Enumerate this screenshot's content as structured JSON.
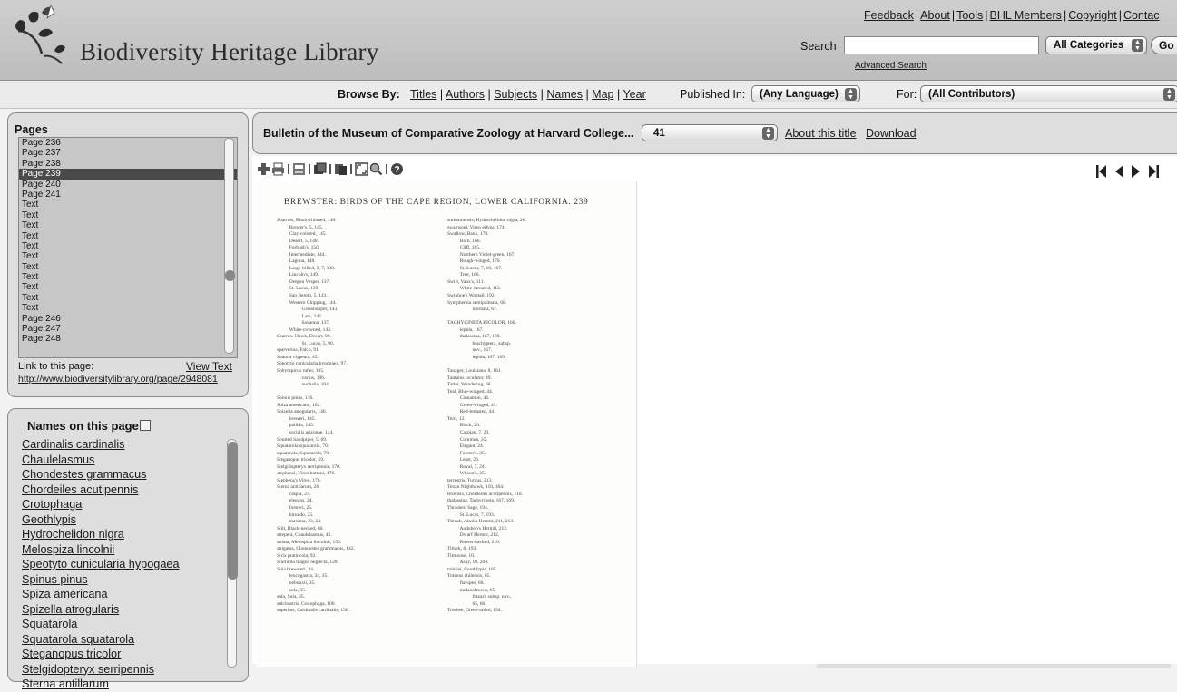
{
  "header": {
    "site_title": "Biodiversity Heritage Library",
    "top_links": [
      "Feedback",
      "About",
      "Tools",
      "BHL Members",
      "Copyright",
      "Contac"
    ],
    "search_label": "Search",
    "search_value": "",
    "category_selected": "All Categories",
    "go_label": "Go",
    "advanced_search": "Advanced Search"
  },
  "browse": {
    "label": "Browse By:",
    "links": [
      "Titles",
      "Authors",
      "Subjects",
      "Names",
      "Map",
      "Year"
    ],
    "published_label": "Published In:",
    "language_selected": "(Any Language)",
    "for_label": "For:",
    "contributors_selected": "(All Contributors)"
  },
  "pages_panel": {
    "title": "Pages",
    "pages": [
      "Page 236",
      "Page 237",
      "Page 238",
      "Page 239",
      "Page 240",
      "Page 241",
      "Text",
      "Text",
      "Text",
      "Text",
      "Text",
      "Text",
      "Text",
      "Text",
      "Text",
      "Text",
      "Text",
      "Page 246",
      "Page 247",
      "Page 248"
    ],
    "selected_index": 3,
    "link_label": "Link to this page:",
    "view_text": "View Text",
    "page_url": "http://www.biodiversitylibrary.org/page/2948081"
  },
  "names_panel": {
    "title": "Names on this page",
    "names": [
      "Cardinalis cardinalis",
      "Chaulelasmus",
      "Chondestes grammacus",
      "Chordeiles acutipennis",
      "Crotophaga",
      "Geothlypis",
      "Hydrochelidon nigra",
      "Melospiza lincolnii",
      "Speotyto cunicularia hypogaea",
      "Spinus pinus",
      "Spiza americana",
      "Spizella atrogularis",
      "Squatarola",
      "Squatarola squatarola",
      "Steganopus tricolor",
      "Stelgidopteryx serripennis",
      "Sterna antillarum"
    ]
  },
  "title_bar": {
    "book_title": "Bulletin of the Museum of Comparative Zoology at Harvard College...",
    "volume_selected": "41",
    "about_title": "About this title",
    "download": "Download"
  },
  "toolbar_icons": [
    "zoom-in-icon",
    "print-icon",
    "info-icon",
    "save-icon",
    "page-view-icon",
    "two-page-icon",
    "fullscreen-icon",
    "search-text-icon",
    "help-icon"
  ],
  "document": {
    "header": "BREWSTER: BIRDS OF THE CAPE REGION, LOWER CALIFORNIA.   239",
    "left_column": [
      "Sparrow, Black-chinned, 148.",
      "          Brewer's, 5, 145.",
      "          Clay-colored, 145.",
      "          Desert, 5, 148.",
      "          Forbush's, 150.",
      "          Intermediate, 144.",
      "          Laguna, 148.",
      "          Large-billed, 5, 7, 138.",
      "          Lincoln's, 149.",
      "          Oregon Vesper, 137.",
      "          St. Lucas, 139.",
      "          San Benito, 5, 141.",
      "          Western Chipping, 144.",
      "                    Grasshopper, 143.",
      "                    Lark, 142.",
      "                    Savanna, 137.",
      "          White-crowned, 143.",
      "Sparrow Hawk, Desert, 90.",
      "                    St. Lucas, 5, 90.",
      "sparverius, Falco, 91.",
      "Spatula clypeata, 45.",
      "Speotyto cunicularia hypogaea, 97.",
      "Sphyrapicus ruber, 105.",
      "                    varius, 106.",
      "                    nuchalis, 104.",
      "",
      "Spinus pinus, 136.",
      "Spiza americana, 162.",
      "Spizella atrogularis, 146.",
      "          breweri, 145.",
      "          pallida, 145.",
      "          socialis arizonae, 144.",
      "Spotted Sandpiper, 5, 69.",
      "Squatarola squatarola, 70.",
      "squatarola, Squatarola, 70.",
      "Steganopus tricolor, 59.",
      "Stelgidopteryx serripennis, 170.",
      "stephensi, Vireo huttoni, 176.",
      "Stephens's Vireo, 176.",
      "Sterna antillarum, 26.",
      "          caspia, 23.",
      "          elegans, 24.",
      "          forsteri, 25.",
      "          hirundo, 25.",
      "          maxima, 23, 24.",
      "Stilt, Black-necked, 60.",
      "strepera, Chaulelasmus, 42.",
      "striata, Melospiza lincolnii, 150.",
      "strigatus, Chondestes grammacus, 142.",
      "Strix pratincola, 92.",
      "Sturnella magna neglecta, 128.",
      "Sula brewsteri, 34.",
      "          leucogastra, 34, 35.",
      "          nebouxii, 35.",
      "          sula, 35.",
      "sula, Sula, 35.",
      "sulcirostris, Crotophaga, 100.",
      "superbus, Cardinalis cardinalis, 156."
    ],
    "right_column": [
      "surinamensis, Hydrochelidon nigra, 26.",
      "swainsoni, Vireo gilvus, 174.",
      "Swallow, Bank, 170.",
      "          Barn, 166.",
      "          Cliff, 165.",
      "          Northern Violet-green, 167.",
      "          Rough-winged, 170.",
      "          St. Lucas, 7, 10, 167.",
      "          Tree, 166.",
      "Swift, Vaux's, 111.",
      "          White-throated, 112.",
      "Swinhoe's Wagtail, 192.",
      "Symphemia semipalmata, 68.",
      "                    inornata, 67.",
      "",
      "TACHYCINETA BICOLOR, 166.",
      "          lepida, 167.",
      "          thalassina, 167, 169.",
      "                    brachyptera, subsp.",
      "                    nov., 167.",
      "                    lepida, 167, 169.",
      "",
      "Tanager, Louisiana, 8, 163.",
      "Tantalus loculator, 49.",
      "Tatler, Wandering, 68.",
      "Teal, Blue-winged, 44.",
      "          Cinnamon, 44.",
      "          Green-winged, 43.",
      "          Red-breasted, 44.",
      "Tern, 12.",
      "          Black, 26.",
      "          Caspian, 7, 23.",
      "          Common, 25.",
      "          Elegant, 24.",
      "          Forster's, 25.",
      "          Least, 26.",
      "          Royal, 7, 24.",
      "          Wilson's, 25.",
      "terrestris, Turdus, 213.",
      "Texan Nighthawk, 110, 164.",
      "texensis, Chordeiles acutipennis, 110.",
      "thalassina, Tachycineta, 167, 169.",
      "Thrasher, Sage, 194.",
      "          St. Lucas, 7, 193.",
      "Thrush, Alaska Hermit, 211, 213.",
      "          Audubon's Hermit, 212.",
      "          Dwarf Hermit, 212.",
      "          Russet-backed, 210.",
      "Titlark, 6, 193.",
      "Titmouse, 10.",
      "          Ashy, 10, 204.",
      "tolmiei, Geothlypis, 185.",
      "Totanus chilensis, 65.",
      "          flavipes, 66.",
      "          melanoleucus, 65.",
      "                    frazari, subsp. nov.,",
      "                    65, 66.",
      "Towhee, Green-tailed, 154."
    ]
  }
}
